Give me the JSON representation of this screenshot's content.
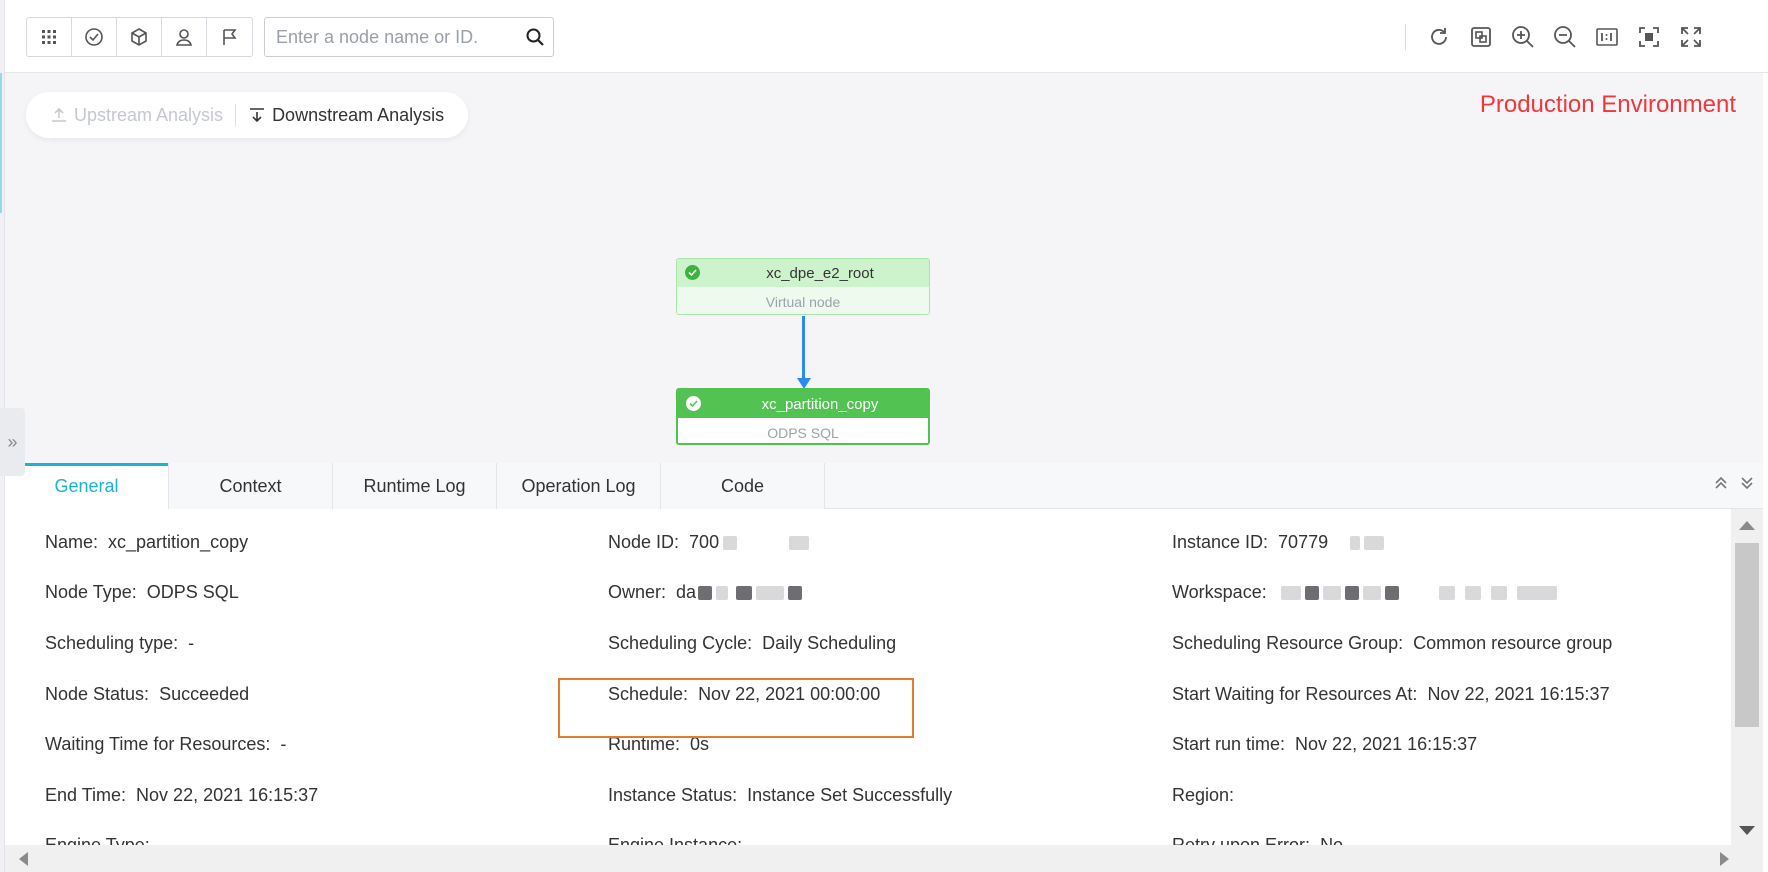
{
  "search": {
    "placeholder": "Enter a node name or ID."
  },
  "toolbar_icons": [
    "grid-icon",
    "check-circle-icon",
    "cube-icon",
    "user-icon",
    "flag-icon"
  ],
  "right_toolbar_icons": [
    "refresh-icon",
    "layout-icon",
    "zoom-in-icon",
    "zoom-out-icon",
    "actual-size-icon",
    "fit-screen-icon",
    "fullscreen-icon"
  ],
  "analysis": {
    "upstream": "Upstream Analysis",
    "downstream": "Downstream Analysis"
  },
  "environment": "Production Environment",
  "nodes": [
    {
      "name": "xc_dpe_e2_root",
      "type": "Virtual node",
      "status": "succeeded"
    },
    {
      "name": "xc_partition_copy",
      "type": "ODPS SQL",
      "status": "succeeded"
    }
  ],
  "tabs": [
    "General",
    "Context",
    "Runtime Log",
    "Operation Log",
    "Code"
  ],
  "active_tab": "General",
  "details": {
    "name": {
      "label": "Name:",
      "value": "xc_partition_copy"
    },
    "node_id": {
      "label": "Node ID:",
      "value": "700"
    },
    "instance_id": {
      "label": "Instance ID:",
      "value": "70779"
    },
    "node_type": {
      "label": "Node Type:",
      "value": "ODPS SQL"
    },
    "owner": {
      "label": "Owner:",
      "value": "da"
    },
    "workspace": {
      "label": "Workspace:",
      "value": ""
    },
    "scheduling_type": {
      "label": "Scheduling type:",
      "value": "-"
    },
    "scheduling_cycle": {
      "label": "Scheduling Cycle:",
      "value": "Daily Scheduling"
    },
    "resource_group": {
      "label": "Scheduling Resource Group:",
      "value": "Common resource group"
    },
    "node_status": {
      "label": "Node Status:",
      "value": "Succeeded"
    },
    "schedule": {
      "label": "Schedule:",
      "value": "Nov 22, 2021 00:00:00"
    },
    "start_waiting": {
      "label": "Start Waiting for Resources At:",
      "value": "Nov 22, 2021 16:15:37"
    },
    "waiting_time": {
      "label": "Waiting Time for Resources:",
      "value": "-"
    },
    "runtime": {
      "label": "Runtime:",
      "value": "0s"
    },
    "start_run": {
      "label": "Start run time:",
      "value": "Nov 22, 2021 16:15:37"
    },
    "end_time": {
      "label": "End Time:",
      "value": "Nov 22, 2021 16:15:37"
    },
    "instance_status": {
      "label": "Instance Status:",
      "value": "Instance Set Successfully"
    },
    "region": {
      "label": "Region:",
      "value": ""
    },
    "engine_type": {
      "label": "Engine Type:",
      "value": ""
    },
    "engine_instance": {
      "label": "Engine Instance:",
      "value": ""
    },
    "retry": {
      "label": "Retry upon Error:",
      "value": "No"
    }
  },
  "colors": {
    "accent": "#1ab3d6",
    "environment": "#f0373c",
    "success": "#52c352",
    "edge": "#2a8cef",
    "highlight": "#e47a2e"
  }
}
